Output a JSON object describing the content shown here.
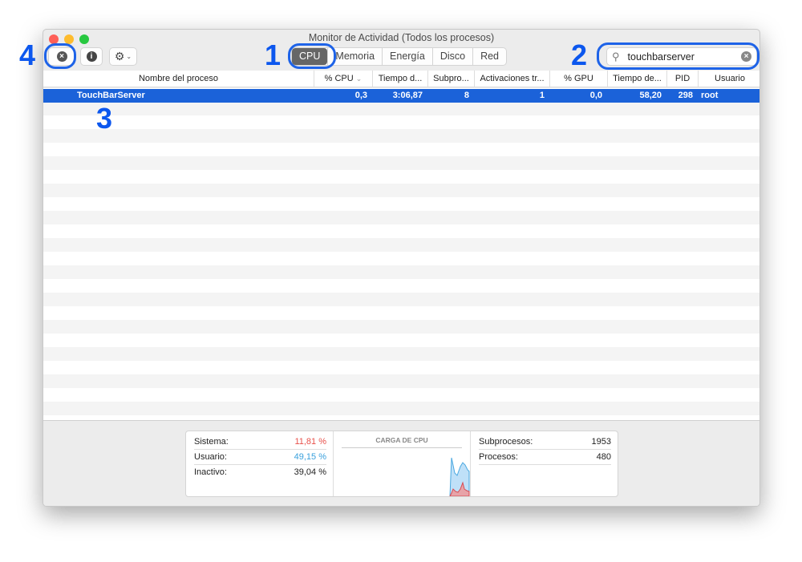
{
  "window": {
    "title": "Monitor de Actividad (Todos los procesos)"
  },
  "toolbar": {
    "tabs": [
      "CPU",
      "Memoria",
      "Energía",
      "Disco",
      "Red"
    ],
    "active_tab": "CPU",
    "search_value": "touchbarserver"
  },
  "table": {
    "columns": [
      "Nombre del proceso",
      "% CPU",
      "Tiempo d...",
      "Subpro...",
      "Activaciones tr...",
      "% GPU",
      "Tiempo de...",
      "PID",
      "Usuario"
    ],
    "rows": [
      {
        "name": "TouchBarServer",
        "cpu": "0,3",
        "time": "3:06,87",
        "threads": "8",
        "wakeups": "1",
        "gpu": "0,0",
        "gpu_time": "58,20",
        "pid": "298",
        "user": "root"
      }
    ]
  },
  "summary": {
    "sistema_label": "Sistema:",
    "sistema": "11,81 %",
    "usuario_label": "Usuario:",
    "usuario": "49,15 %",
    "inactivo_label": "Inactivo:",
    "inactivo": "39,04 %",
    "chart_title": "CARGA DE CPU",
    "subprocesos_label": "Subprocesos:",
    "subprocesos": "1953",
    "procesos_label": "Procesos:",
    "procesos": "480"
  },
  "colors": {
    "system": "#e8504a",
    "user": "#3aa0dc",
    "selection": "#1b62d9",
    "annotation": "#0c57ee"
  },
  "annotations": [
    "1",
    "2",
    "3",
    "4"
  ]
}
